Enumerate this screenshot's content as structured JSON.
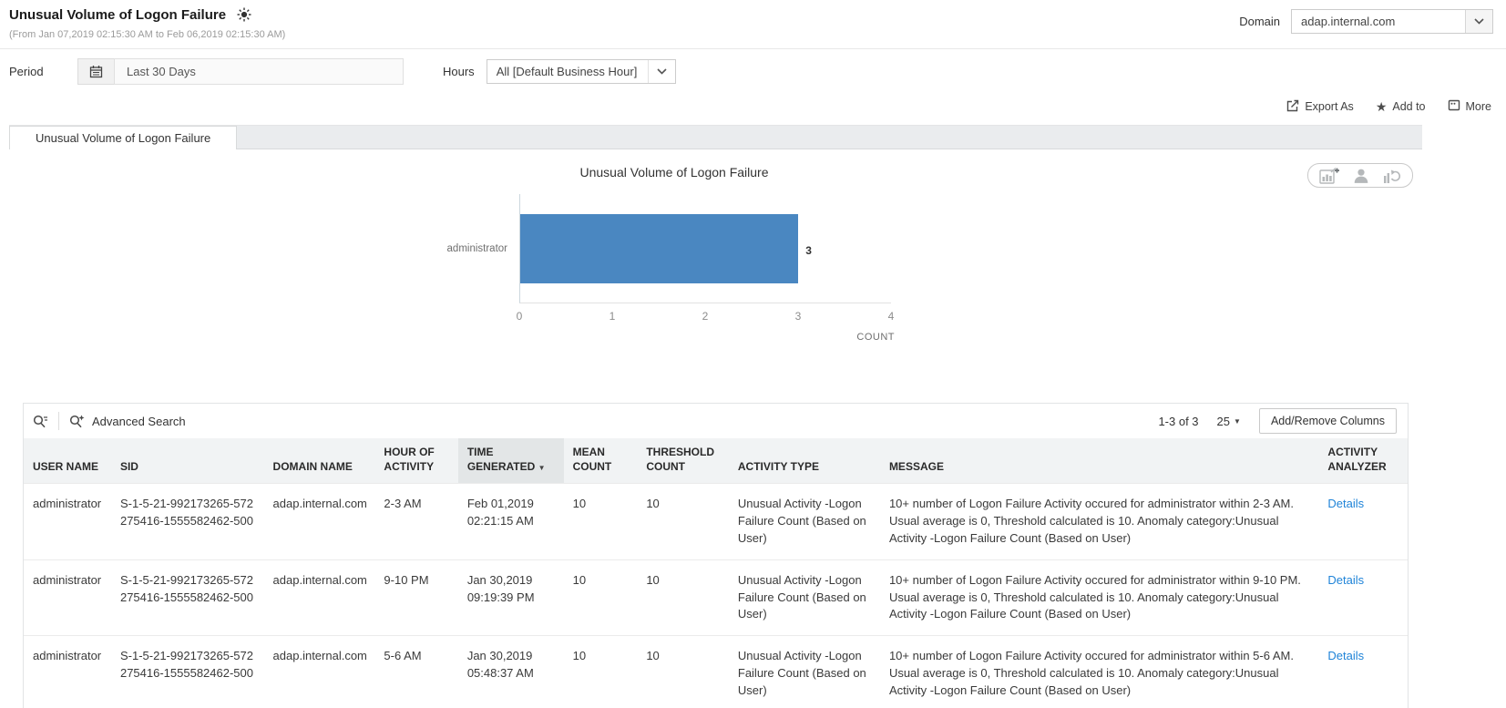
{
  "header": {
    "title": "Unusual Volume of Logon Failure",
    "subtitle": "(From Jan 07,2019 02:15:30 AM to Feb 06,2019 02:15:30 AM)",
    "domain_label": "Domain",
    "domain_value": "adap.internal.com"
  },
  "filters": {
    "period_label": "Period",
    "period_value": "Last 30 Days",
    "hours_label": "Hours",
    "hours_value": "All [Default Business Hour]"
  },
  "actions": {
    "export_as": "Export As",
    "add_to": "Add to",
    "more": "More"
  },
  "tabs": [
    {
      "label": "Unusual Volume of Logon Failure",
      "active": true
    }
  ],
  "icons": {
    "add_to_star": "★",
    "sort_desc": "▼",
    "page_size_caret": "▼"
  },
  "chart_data": {
    "type": "bar",
    "orientation": "horizontal",
    "title": "Unusual Volume of Logon Failure",
    "categories": [
      "administrator"
    ],
    "values": [
      3
    ],
    "xlabel": "COUNT",
    "ylabel": "",
    "xlim": [
      0,
      4
    ],
    "xticks": [
      0,
      1,
      2,
      3,
      4
    ],
    "bar_color": "#4a87c1",
    "grid": false,
    "legend": "none"
  },
  "table": {
    "toolbar": {
      "advanced_search_label": "Advanced Search",
      "pagination": "1-3 of 3",
      "page_size": "25",
      "add_remove_columns_label": "Add/Remove Columns"
    },
    "columns": [
      "USER NAME",
      "SID",
      "DOMAIN NAME",
      "HOUR OF ACTIVITY",
      "TIME GENERATED",
      "MEAN COUNT",
      "THRESHOLD COUNT",
      "ACTIVITY TYPE",
      "MESSAGE",
      "ACTIVITY ANALYZER"
    ],
    "sorted_column": "TIME GENERATED",
    "sort_direction": "desc",
    "rows": [
      {
        "user_name": "administrator",
        "sid": "S-1-5-21-992173265-572275416-1555582462-500",
        "domain_name": "adap.internal.com",
        "hour_of_activity": "2-3 AM",
        "time_generated": "Feb 01,2019\n02:21:15 AM",
        "mean_count": "10",
        "threshold_count": "10",
        "activity_type": "Unusual Activity -Logon Failure Count (Based on User)",
        "message": "10+ number of Logon Failure Activity occured for administrator within 2-3 AM. Usual average is 0, Threshold calculated is 10. Anomaly category:Unusual Activity -Logon Failure Count (Based on User)",
        "analyzer": "Details"
      },
      {
        "user_name": "administrator",
        "sid": "S-1-5-21-992173265-572275416-1555582462-500",
        "domain_name": "adap.internal.com",
        "hour_of_activity": "9-10 PM",
        "time_generated": "Jan 30,2019\n09:19:39 PM",
        "mean_count": "10",
        "threshold_count": "10",
        "activity_type": "Unusual Activity -Logon Failure Count (Based on User)",
        "message": "10+ number of Logon Failure Activity occured for administrator within 9-10 PM. Usual average is 0, Threshold calculated is 10. Anomaly category:Unusual Activity -Logon Failure Count (Based on User)",
        "analyzer": "Details"
      },
      {
        "user_name": "administrator",
        "sid": "S-1-5-21-992173265-572275416-1555582462-500",
        "domain_name": "adap.internal.com",
        "hour_of_activity": "5-6 AM",
        "time_generated": "Jan 30,2019\n05:48:37 AM",
        "mean_count": "10",
        "threshold_count": "10",
        "activity_type": "Unusual Activity -Logon Failure Count (Based on User)",
        "message": "10+ number of Logon Failure Activity occured for administrator within 5-6 AM. Usual average is 0, Threshold calculated is 10. Anomaly category:Unusual Activity -Logon Failure Count (Based on User)",
        "analyzer": "Details"
      }
    ]
  }
}
